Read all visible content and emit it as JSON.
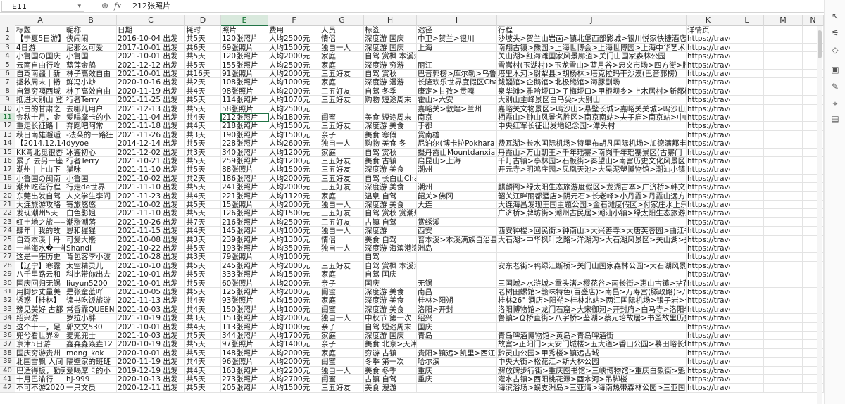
{
  "formula_bar": {
    "name_box": "E11",
    "name_caret": "▾",
    "zoom_icon": "⊕",
    "fx_label": "fx",
    "content": "212张照片"
  },
  "columns": [
    {
      "letter": "A"
    },
    {
      "letter": "B"
    },
    {
      "letter": "C"
    },
    {
      "letter": "D"
    },
    {
      "letter": "E"
    },
    {
      "letter": "F"
    },
    {
      "letter": "G"
    },
    {
      "letter": "H"
    },
    {
      "letter": "I"
    },
    {
      "letter": "J"
    },
    {
      "letter": "K"
    },
    {
      "letter": "L"
    },
    {
      "letter": "M"
    },
    {
      "letter": "N"
    }
  ],
  "active_cell": {
    "column": "E",
    "row": 11
  },
  "rows": [
    {
      "n": "1",
      "c": [
        "标题",
        "昵称",
        "日期",
        "耗时",
        "照片",
        "费用",
        "人员",
        "标签",
        "途径",
        "行程",
        "详情页",
        "",
        "",
        ""
      ]
    },
    {
      "n": "2",
      "c": [
        "【宁夏5日游】",
        "侠闹闹",
        "2016-10-04 出发",
        "共5天",
        "120张照片",
        "人均2500元",
        "情侣",
        "深度游 国庆",
        "中卫>贺兰>银川",
        "沙坡头>贺兰山岩画>镇北堡西部影城>银川悦家快捷酒店",
        "https://travel.qunar.com/travelb",
        "",
        "",
        ""
      ]
    },
    {
      "n": "3",
      "c": [
        "4日游",
        "尼邪么可爱",
        "2017-10-01 出发",
        "共6天",
        "69张照片",
        "人均1500元",
        "独自一人",
        "深度游 国庆",
        "上海",
        "南翔古镇>豫园>上海世博会>上海世博园>上海中华艺术",
        "https://travel.qunar.com/travelb",
        "",
        "",
        ""
      ]
    },
    {
      "n": "4",
      "c": [
        "小鲁国の国庆",
        "小鲁国",
        "2021-10-01 出发",
        "共5天",
        "120张照片",
        "人均2000元",
        "家庭",
        "自驾 赏枫 本溪满族自治县>盘锦",
        "",
        "关山湖>红海滩国家风景廊道>关门山国家森林公园",
        "https://travel.qunar.com/travelb",
        "",
        "",
        ""
      ]
    },
    {
      "n": "5",
      "c": [
        "云南自由行攻",
        "蓝莲金鸽",
        "2021-12-12 出发",
        "共5天",
        "155张照片",
        "人均2500元",
        "家庭",
        "深度游 穷游",
        "丽江",
        "雪嵩村(玉湖村)>玉龙雪山>蓝月谷>忠义市场>四方街>腊",
        "https://travel.qunar.com/travelb",
        "",
        "",
        ""
      ]
    },
    {
      "n": "6",
      "c": [
        "自驾南疆 | 新",
        "林子高效自由",
        "2021-10-01 出发",
        "共16天",
        "91张照片",
        "人均2000元",
        "三五好友",
        "自驾 赏秋",
        "巴音郭楞>库尔勒>乌鲁",
        "塔里木河>尉犁县>胡杨林>塔克拉玛干沙漠(巴音郭楞)",
        "https://travel.qunar.com/travelb",
        "",
        "",
        ""
      ]
    },
    {
      "n": "7",
      "c": [
        "拯救周末 | 畅",
        "鲜冯小炒",
        "2020-10-16 出发",
        "共2天",
        "108张照片",
        "人均1000元",
        "家庭",
        "深度游 漫游",
        "长隆欢乐世界度假区Changl",
        "鲅鲻馆>企鹅馆>北极熊馆>海豚剧场",
        "https://travel.qunar.com/travelb",
        "",
        "",
        ""
      ]
    },
    {
      "n": "8",
      "c": [
        "自驾穷嘎西域",
        "林子高效自由",
        "2020-11-19 出发",
        "共4天",
        "98张照片",
        "人均2000元",
        "三五好友",
        "自驾 冬季",
        "康定>甘孜>贡嘎",
        "泉华滩>雅哈垭口>子梅垭口>甲根坝乡>上木居村>新都桥",
        "https://travel.qunar.com/travelb",
        "",
        "",
        ""
      ]
    },
    {
      "n": "9",
      "c": [
        "抵进大别山 登",
        "行者Terry",
        "2021-11-25 出发",
        "共5天",
        "114张照片",
        "人均1070元",
        "三五好友",
        "购物 短途周末",
        "霍山>六安",
        "大别山主峰景区白马尖>大别山",
        "https://travel.qunar.com/travelb",
        "",
        "",
        ""
      ]
    },
    {
      "n": "10",
      "c": [
        "小白的甘肃之",
        "去哪儿用户",
        "2021-12-13 出发",
        "共5天",
        "58张照片",
        "人均2500元",
        "",
        "",
        "嘉峪关>敦煌>兰州",
        "嘉峪关文物景区>鸣沙山>悬壁长城>嘉峪关关城>鸣沙山月",
        "https://travel.qunar.com/travelb",
        "",
        "",
        ""
      ]
    },
    {
      "n": "11",
      "c": [
        "金秋十月，金",
        "爱喝摩卡的小",
        "2021-11-04 出发",
        "共4天",
        "212张照片",
        "人均1800元",
        "闺蜜",
        "美食 短途周末",
        "南京",
        "栖霞山>钟山风景名胜区>南京南站>夫子庙>南京站>中山陵",
        "https://travel.qunar.com/travelb",
        "",
        "",
        ""
      ]
    },
    {
      "n": "12",
      "c": [
        "重走长征路丨",
        "奔跑吧阿常",
        "2021-11-18 出发",
        "共4天",
        "218张照片",
        "人均1500元",
        "三五好友",
        "深度游 美食",
        "于都",
        "中央红军长征出发地纪念园>潭头村",
        "https://travel.qunar.com/travelb",
        "",
        "",
        ""
      ]
    },
    {
      "n": "13",
      "c": [
        "秋日南雄邂逅",
        "-法朵的一路狂",
        "2021-11-26 出发",
        "共3天",
        "190张照片",
        "人均1500元",
        "亲子",
        "美食 寒假",
        "赏南雄",
        "",
        "https://travel.qunar.com/travelb",
        "",
        "",
        ""
      ]
    },
    {
      "n": "14",
      "c": [
        "【2014.12.14",
        "dyyoe",
        "2014-12-14 出发",
        "共5天",
        "228张照片",
        "人均2600元",
        "独自一人",
        "购物 美食 冬",
        "尼泊尔(博卡拉Pokhara",
        "费瓦湖>长水国际机场>特里布胡凡国际机场>加德满都丰",
        "https://travel.qunar.com/travelb",
        "",
        "",
        ""
      ]
    },
    {
      "n": "15",
      "c": [
        "KK粤北觅银杏",
        "冰鉴初心",
        "2021-12-02 出发",
        "共3天",
        "340张照片",
        "人均1200元",
        "家庭",
        "自驾 赏秋",
        "摄丹霞山Mountdanxia>连",
        "丹霞山>万山朝王>千年瑶寨>南岗千年瑶寨景区(古寨门",
        "https://travel.qunar.com/travelb",
        "",
        "",
        ""
      ]
    },
    {
      "n": "16",
      "c": [
        "累了 去另一座",
        "行者Terry",
        "2021-10-21 出发",
        "共5天",
        "259张照片",
        "人均1200元",
        "三五好友",
        "美食 古镇",
        "启昆山>上海",
        "千灯古镇>亭林园>石板街>秦望山>南宫历史文化风景区>",
        "https://travel.qunar.com/travelb",
        "",
        "",
        ""
      ]
    },
    {
      "n": "17",
      "c": [
        "潮州 | 上山下",
        "猫咪",
        "2021-11-10 出发",
        "共5天",
        "88张照片",
        "人均1500元",
        "三五好友",
        "深度游 美食",
        "潮州",
        "开元寺>明鸿庄园>凤凰天池>大吴泥塑博物馆>潮汕小镇",
        "https://travel.qunar.com/travelb",
        "",
        "",
        ""
      ]
    },
    {
      "n": "18",
      "c": [
        "小鲁国の闽南",
        "小鲁国",
        "2021-10-02 出发",
        "共2天",
        "186张照片",
        "人均2000元",
        "三五好友",
        "自驾 长白山Changbaishan",
        "",
        "",
        "https://travel.qunar.com/travelb",
        "",
        "",
        ""
      ]
    },
    {
      "n": "19",
      "c": [
        "潮州吃逛行程",
        "行走de世界",
        "2021-11-10 出发",
        "共5天",
        "241张照片",
        "人均2000元",
        "三五好友",
        "深度游 美食",
        "潮州",
        "麒麟阁>绿太阳生态旅游度假区>龙湖古寨>广济桥>韩文公",
        "https://travel.qunar.com/travelb",
        "",
        "",
        ""
      ]
    },
    {
      "n": "20",
      "c": [
        "东莞出发自驾",
        "人文学生李阎",
        "2021-11-23 出发",
        "共4天",
        "221张照片",
        "人均1120元",
        "家庭",
        "温泉 自驾",
        "韶关>佛冈",
        "韶关江畔丽都酒店>阴元石>长老峰>小丹霞>丹霞山远方",
        "https://travel.qunar.com/travelb",
        "",
        "",
        ""
      ]
    },
    {
      "n": "21",
      "c": [
        "大连旅游攻略",
        "寄旅悠悠",
        "2021-10-02 出发",
        "共5天",
        "15张照片",
        "人均2000元",
        "独自一人",
        "深度游 美食",
        "大连",
        "大连海昌发现王国主题公园>金石滩度假区>付家庄水上乐",
        "https://travel.qunar.com/travelb",
        "",
        "",
        ""
      ]
    },
    {
      "n": "22",
      "c": [
        "发现潮州5天",
        "白色影姐",
        "2021-11-10 出发",
        "共5天",
        "126张照片",
        "人均1500元",
        "三五好友",
        "自驾 赏秋 赏潮州",
        "",
        "广济桥>牌坊街>潮州古民居>潮汕小镇>绿太阳生态旅游度",
        "https://travel.qunar.com/travelb",
        "",
        "",
        ""
      ]
    },
    {
      "n": "23",
      "c": [
        "红土地之旅——",
        "潮涨潮落",
        "2021-10-26 出发",
        "共7天",
        "216张照片",
        "人均2500元",
        "三五好友",
        "古镇 自驾",
        "赏绣溪",
        "",
        "https://travel.qunar.com/travelb",
        "",
        "",
        ""
      ]
    },
    {
      "n": "24",
      "c": [
        "肆年 | 我的故",
        "恩和猩猩",
        "2021-11-15 出发",
        "共4天",
        "145张照片",
        "人均1000元",
        "独自一人",
        "深度游",
        "西安",
        "西安钟楼>回民街>钟南山>大兴善寺>大唐芙蓉园>曲江书城",
        "https://travel.qunar.com/travelb",
        "",
        "",
        ""
      ]
    },
    {
      "n": "25",
      "c": [
        "自驾本溪 | 丹",
        "可爱大熊",
        "2021-10-08 出发",
        "共3天",
        "239张照片",
        "人均1300元",
        "情侣",
        "美食 自驾",
        "普本溪>本溪满族自治县",
        "大石湖>中华枫叶之路>洋湖沟>大石湖风景区>关山湖>关门",
        "https://travel.qunar.com/travelb",
        "",
        "",
        ""
      ]
    },
    {
      "n": "26",
      "c": [
        "一半海水�一半",
        "Shandi",
        "2021-10-22 出发",
        "共5天",
        "193张照片",
        "人均3500元",
        "独自一人",
        "深度游 海滨港湾",
        "洲岛",
        "",
        "https://travel.qunar.com/travelb",
        "",
        "",
        ""
      ]
    },
    {
      "n": "27",
      "c": [
        "这是一座历史",
        "背包客李小波",
        "2021-10-28 出发",
        "共3天",
        "79张照片",
        "人均1000元",
        "",
        "自驾",
        "",
        "",
        "https://travel.qunar.com/travelb",
        "",
        "",
        ""
      ]
    },
    {
      "n": "28",
      "c": [
        "【辽宁】寒露",
        "太空精灵儿",
        "2021-10-10 出发",
        "共5天",
        "245张照片",
        "人均2000元",
        "三五好友",
        "自驾 赏枫 本溪满族自治县",
        "",
        "安东老街>鸭绿江断桥>关门山国家森林公园>大石湖风景区",
        "https://travel.qunar.com/travelb",
        "",
        "",
        ""
      ]
    },
    {
      "n": "29",
      "c": [
        "八千里路云和",
        "科比带你出去",
        "2021-10-01 出发",
        "共5天",
        "333张照片",
        "人均1500元",
        "家庭",
        "自驾 国庆",
        "",
        "",
        "https://travel.qunar.com/travelb",
        "",
        "",
        ""
      ]
    },
    {
      "n": "30",
      "c": [
        "国庆回归无锡",
        "liuyun5200",
        "2021-10-01 出发",
        "共5天",
        "60张照片",
        "人均2000元",
        "亲子",
        "国庆",
        "无锡",
        "三国城>水浒城>鼋头渚>樱花谷>南长街>惠山古镇>拈花湾",
        "https://travel.qunar.com/travelb",
        "",
        "",
        ""
      ]
    },
    {
      "n": "31",
      "c": [
        "用脚步丈量美",
        "是张童蓝吖",
        "2021-10-05 出发",
        "共5天",
        "125张照片",
        "人均2000元",
        "闺蜜",
        "深度游 美食",
        "南昌",
        "老树田螺馆>赣味特色(百盛店)>南昌>万寿宫(滕政路)>八",
        "https://travel.qunar.com/travelb",
        "",
        "",
        ""
      ]
    },
    {
      "n": "32",
      "c": [
        "诱惑【桂林】",
        "读书吃饭旅游",
        "2021-11-13 出发",
        "共4天",
        "93张照片",
        "人均1500元",
        "家庭",
        "深度游 美食",
        "桂林>阳朔",
        "桂林26° 酒店>阳朔>桂林北站>两江国际机场>银子岩>十",
        "https://travel.qunar.com/travelb",
        "",
        "",
        ""
      ]
    },
    {
      "n": "33",
      "c": [
        "豫见美好 古都",
        "常香霏QUEEN",
        "2021-10-03 出发",
        "共4天",
        "150张照片",
        "人均1000元",
        "闺蜜",
        "深度游 美食",
        "洛阳>开封",
        "洛阳博物馆>龙门石窟>大宋御河>开封府>白马寺>洛阳老城",
        "https://travel.qunar.com/travelb",
        "",
        "",
        ""
      ]
    },
    {
      "n": "34",
      "c": [
        "绍兴游",
        "罗拉小胖",
        "2021-10-19 出发",
        "共3天",
        "153张照片",
        "人均2000元",
        "独自一人",
        "中秋节 第一次",
        "绍兴",
        "鲁镇>仓桥直街>八字桥>鉴湖>蔡元培故居>书圣故里历史街",
        "https://travel.qunar.com/travelb",
        "",
        "",
        ""
      ]
    },
    {
      "n": "35",
      "c": [
        "这个十一，足",
        "郭文文530",
        "2021-10-01 出发",
        "共4天",
        "113张照片",
        "人均1000元",
        "亲子",
        "自驾 短途周末",
        "国庆",
        "",
        "https://travel.qunar.com/travelb",
        "",
        "",
        ""
      ]
    },
    {
      "n": "36",
      "c": [
        "兜兮看世界⑥",
        "麦兜兜士",
        "2021-10-03 出发",
        "共5天",
        "344张照片",
        "人均1700元",
        "家庭",
        "深度游 国庆",
        "青岛",
        "青岛啤酒博物馆>黄岛>青岛啤酒街",
        "https://travel.qunar.com/travelb",
        "",
        "",
        ""
      ]
    },
    {
      "n": "37",
      "c": [
        "京津5日游",
        "鑫森淼焱垚12",
        "2020-10-19 出发",
        "共5天",
        "97张照片",
        "人均1400元",
        "亲子",
        "美食 北京>天津>怀柔",
        "",
        "故宫>正阳门>天安门城楼>五大道>香山公园>慕田峪长城>国",
        "https://travel.qunar.com/travelb",
        "",
        "",
        ""
      ]
    },
    {
      "n": "38",
      "c": [
        "国庆穷游贵州",
        "mong_kok",
        "2020-10-01 出发",
        "共5天",
        "148张照片",
        "人均2000元",
        "家庭",
        "穷游 古镇",
        "贵阳>镇远>凯里>西江千户",
        "黔灵山公园>甲秀楼>镇远古城",
        "https://travel.qunar.com/travelb",
        "",
        "",
        ""
      ]
    },
    {
      "n": "39",
      "c": [
        "北国雪飘 人间",
        "隔壁家的班班",
        "2020-11-19 出发",
        "共4天",
        "96张照片",
        "人均2000元",
        "闺蜜",
        "冬季 第一次",
        "哈尔滨",
        "中央大街>松花江>斯大林公园",
        "https://travel.qunar.com/travelb",
        "",
        "",
        ""
      ]
    },
    {
      "n": "40",
      "c": [
        "巴适得板，勤劳",
        "爱喝摩卡的小",
        "2019-12-19 出发",
        "共4天",
        "163张照片",
        "人均2200元",
        "独自一人",
        "美食 冬季",
        "重庆",
        "解放碑步行街>重庆图书馆>三峡博物馆>重庆白象街>魁星楼",
        "https://travel.qunar.com/travelb",
        "",
        "",
        ""
      ]
    },
    {
      "n": "41",
      "c": [
        "十月巴渝行",
        "hj-999",
        "2020-10-13 出发",
        "共5天",
        "273张照片",
        "人均2700元",
        "闺蜜",
        "古镇 自驾",
        "重庆",
        "灌水古镇>西阳桃花源>酉水河>吊脚楼",
        "https://travel.qunar.com/travelb",
        "",
        "",
        ""
      ]
    },
    {
      "n": "42",
      "c": [
        "不可不游2020",
        "一只文员",
        "2020-12-11 出发",
        "共5天",
        "205张照片",
        "人均1500元",
        "三五好友",
        "美食 漫游",
        "",
        "海滨浴场>蜈支洲岛>三亚湾>海南热带森林公园>三亚国际免税城",
        "https://travel.qunar.com/travelb",
        "",
        "",
        ""
      ]
    }
  ]
}
